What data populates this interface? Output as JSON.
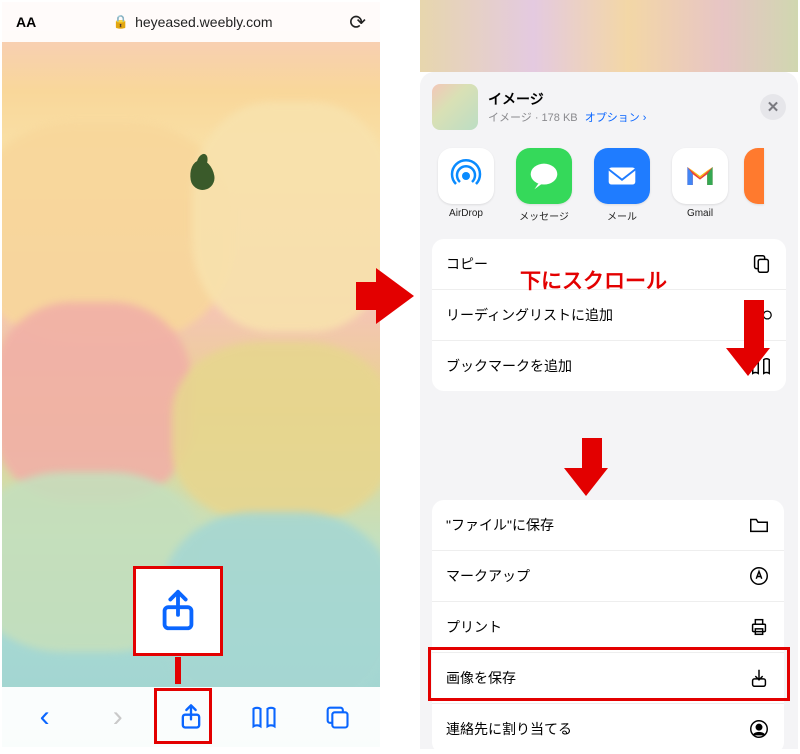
{
  "browser": {
    "url": "heyeased.weebly.com"
  },
  "arrow_hint": "下にスクロール",
  "sheet": {
    "title": "イメージ",
    "subtitle": "イメージ · 178 KB",
    "options_label": "オプション ›"
  },
  "share_targets": [
    {
      "id": "airdrop",
      "label": "AirDrop"
    },
    {
      "id": "message",
      "label": "メッセージ"
    },
    {
      "id": "mail",
      "label": "メール"
    },
    {
      "id": "gmail",
      "label": "Gmail"
    }
  ],
  "actions_top": [
    {
      "id": "copy",
      "label": "コピー",
      "icon": "copy"
    },
    {
      "id": "reading-list",
      "label": "リーディングリストに追加",
      "icon": "glasses"
    },
    {
      "id": "bookmark",
      "label": "ブックマークを追加",
      "icon": "book"
    }
  ],
  "actions_bottom": [
    {
      "id": "save-files",
      "label": "\"ファイル\"に保存",
      "icon": "folder"
    },
    {
      "id": "markup",
      "label": "マークアップ",
      "icon": "markup"
    },
    {
      "id": "print",
      "label": "プリント",
      "icon": "printer"
    },
    {
      "id": "save-image",
      "label": "画像を保存",
      "icon": "download"
    },
    {
      "id": "assign-contact",
      "label": "連絡先に割り当てる",
      "icon": "contact"
    }
  ]
}
